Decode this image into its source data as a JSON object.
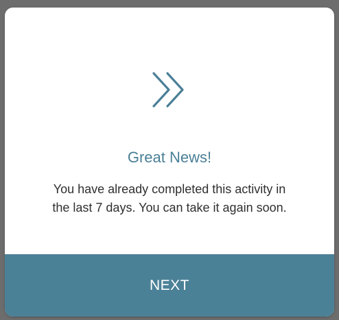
{
  "modal": {
    "icon": "double-chevron-right-icon",
    "title": "Great News!",
    "message": "You have already completed this activity in the last 7 days. You can take it again soon.",
    "next_label": "NEXT"
  },
  "colors": {
    "accent": "#4b8197",
    "title": "#4a7f97",
    "body_text": "#2f2f2f",
    "backdrop": "#6d6d6d",
    "card": "#ffffff"
  }
}
